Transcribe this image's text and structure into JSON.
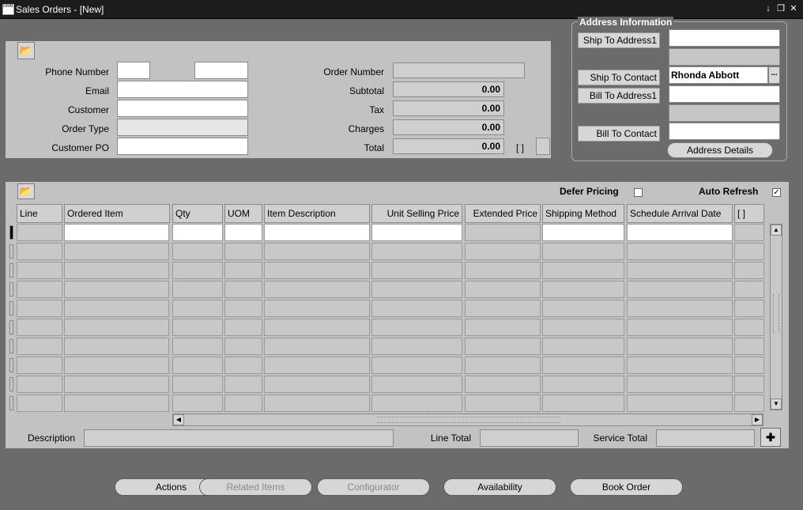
{
  "window": {
    "title": "Sales Orders - [New]",
    "app_icon_text": "ORACLE"
  },
  "header": {
    "phone_label": "Phone Number",
    "phone_part1": "",
    "phone_part2": "",
    "email_label": "Email",
    "email_value": "",
    "customer_label": "Customer",
    "customer_value": "",
    "order_type_label": "Order Type",
    "order_type_value": "",
    "customer_po_label": "Customer PO",
    "customer_po_value": "",
    "order_number_label": "Order Number",
    "order_number_value": "",
    "subtotal_label": "Subtotal",
    "subtotal_value": "0.00",
    "tax_label": "Tax",
    "tax_value": "0.00",
    "charges_label": "Charges",
    "charges_value": "0.00",
    "total_label": "Total",
    "total_value": "0.00",
    "bracket_text": "[ ]"
  },
  "address": {
    "title": "Address Information",
    "ship_to_address_label": "Ship To Address1",
    "ship_to_address_value": "",
    "ship_to_contact_label": "Ship To Contact",
    "ship_to_contact_value": "Rhonda Abbott",
    "ellipsis": "...",
    "bill_to_address_label": "Bill To Address1",
    "bill_to_address_value": "",
    "bill_to_contact_label": "Bill To Contact",
    "bill_to_contact_value": "",
    "details_button": "Address Details"
  },
  "lines": {
    "defer_pricing_label": "Defer Pricing",
    "defer_pricing_checked": false,
    "auto_refresh_label": "Auto Refresh",
    "auto_refresh_checked": true,
    "auto_refresh_mark": "✓",
    "columns": [
      "Line",
      "Ordered Item",
      "Qty",
      "UOM",
      "Item Description",
      "Unit Selling Price",
      "Extended Price",
      "Shipping Method",
      "Schedule Arrival Date",
      "[ ]"
    ],
    "row_count": 10,
    "description_label": "Description",
    "description_value": "",
    "line_total_label": "Line Total",
    "line_total_value": "",
    "service_total_label": "Service Total",
    "service_total_value": ""
  },
  "buttons": {
    "actions": "Actions",
    "related_items": "Related Items",
    "configurator": "Configurator",
    "availability": "Availability",
    "book_order": "Book Order"
  }
}
